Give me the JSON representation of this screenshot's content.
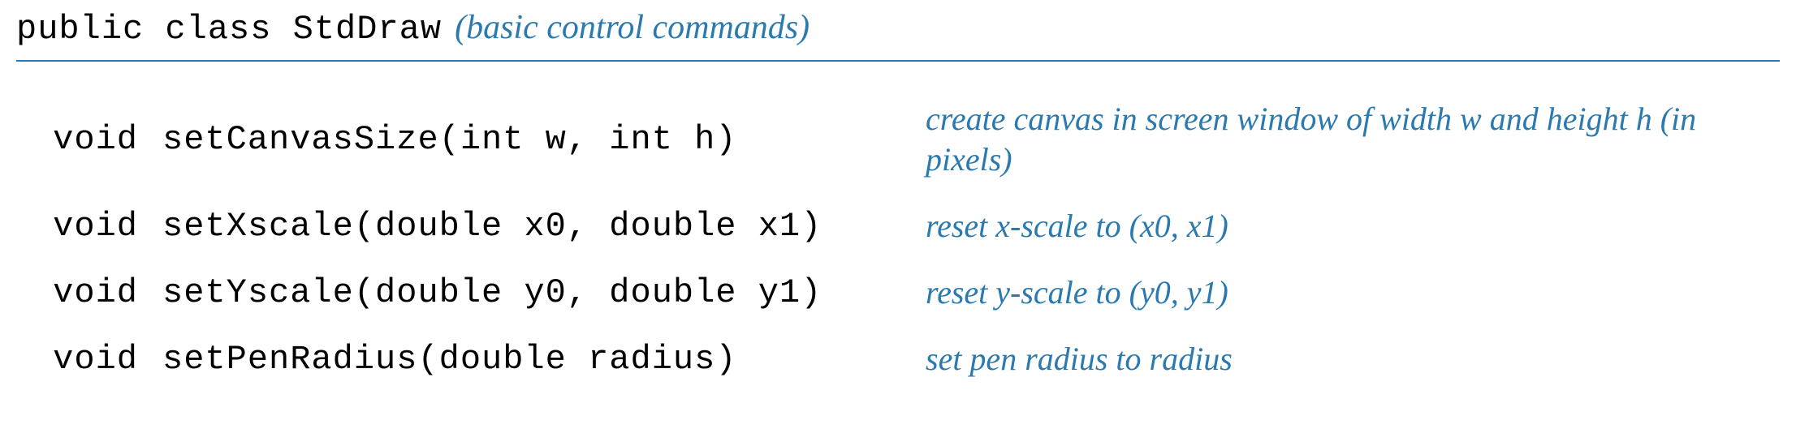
{
  "header": {
    "class_decl": "public class StdDraw",
    "note": "(basic control commands)"
  },
  "methods": [
    {
      "return_type": "void",
      "signature": "setCanvasSize(int w, int h)",
      "description": "create canvas in screen window of width w and height h (in pixels)"
    },
    {
      "return_type": "void",
      "signature": "setXscale(double x0, double x1)",
      "description": "reset x-scale to (x0, x1)"
    },
    {
      "return_type": "void",
      "signature": "setYscale(double y0, double y1)",
      "description": "reset y-scale to (y0, y1)"
    },
    {
      "return_type": "void",
      "signature": "setPenRadius(double radius)",
      "description": "set pen radius to radius"
    }
  ]
}
